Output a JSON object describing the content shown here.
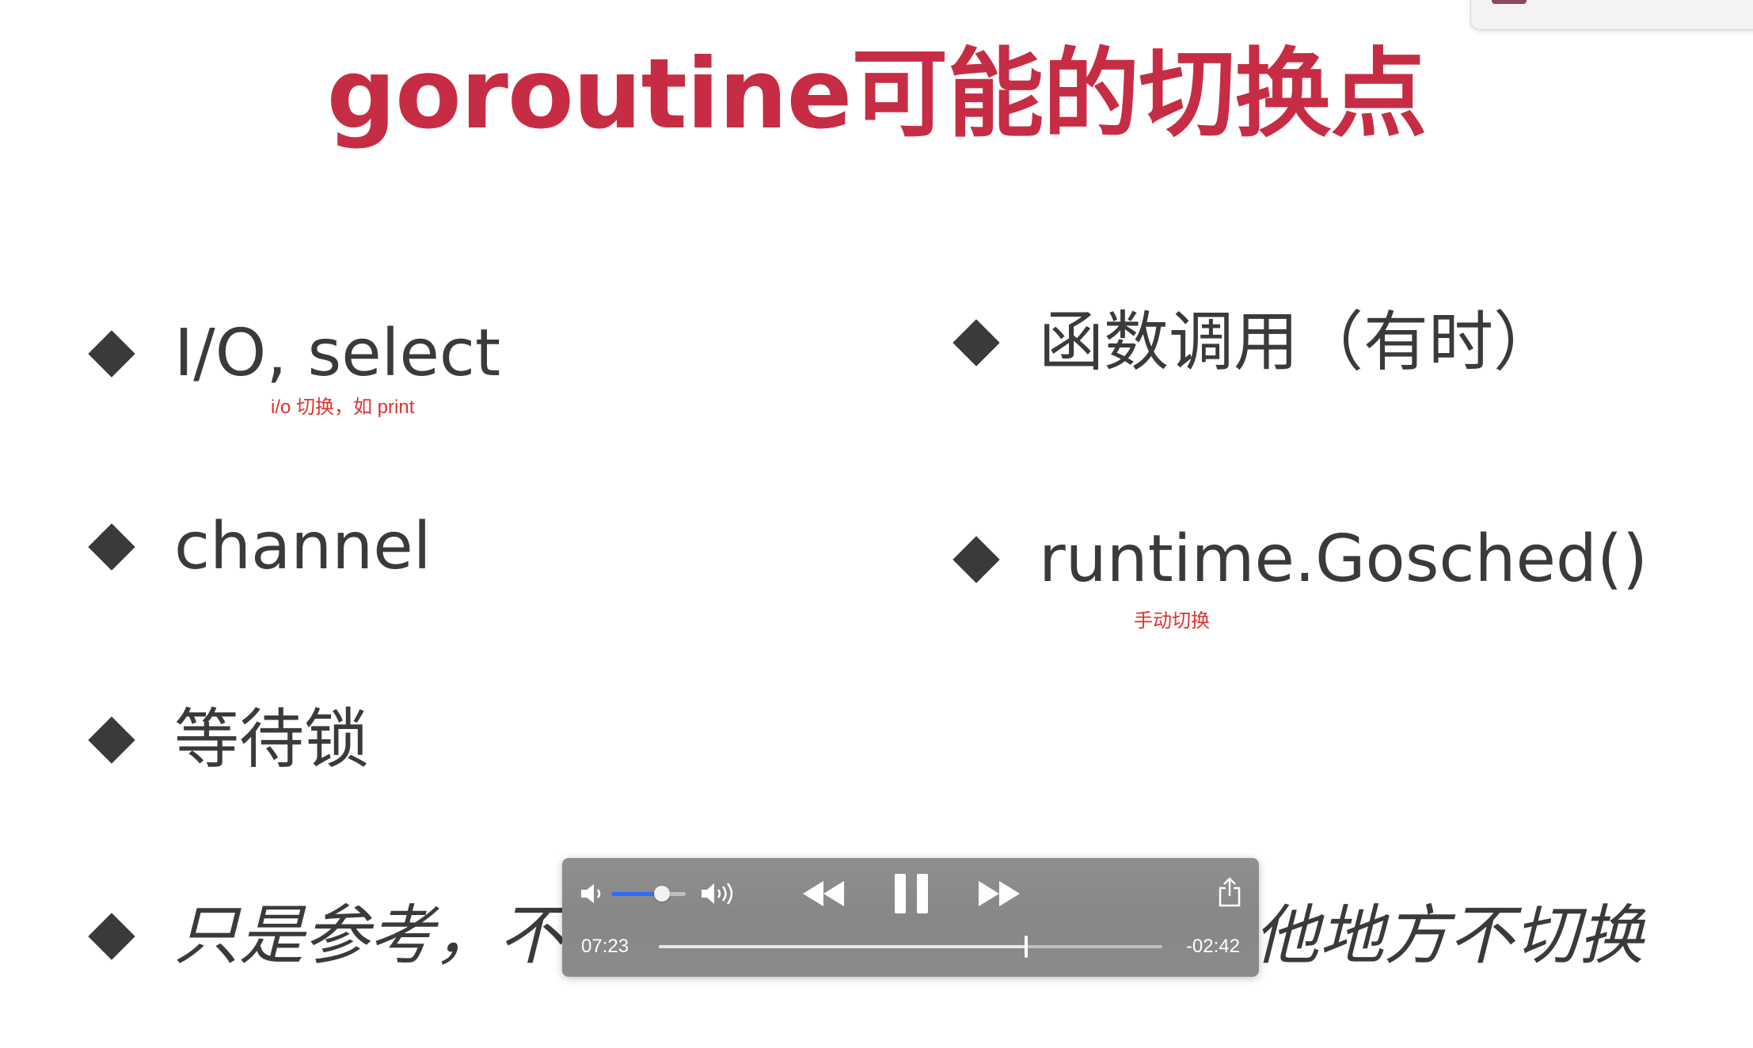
{
  "slide": {
    "title": "goroutine可能的切换点",
    "bullets_left": [
      {
        "text": "I/O, select"
      },
      {
        "text": "channel"
      },
      {
        "text": "等待锁"
      }
    ],
    "bullets_right": [
      {
        "text": "函数调用（有时）"
      },
      {
        "text": "runtime.Gosched()"
      }
    ],
    "bullet_bottom": {
      "text_left": "只是参考，不能",
      "text_right": "他地方不切换"
    },
    "annotations": {
      "io_note": "i/o 切换，如 print",
      "gosched_note": "手动切换"
    },
    "colors": {
      "title": "#c62d45",
      "body_text": "#3a3a3c",
      "annotation": "#e0312f"
    }
  },
  "player": {
    "elapsed": "07:23",
    "remaining": "-02:42",
    "volume_level": 0.68,
    "progress": 0.73,
    "state": "playing",
    "icons": [
      "volume-low-icon",
      "volume-high-icon",
      "rewind-icon",
      "pause-icon",
      "fast-forward-icon",
      "share-icon"
    ],
    "accent": "#2f6bff"
  }
}
